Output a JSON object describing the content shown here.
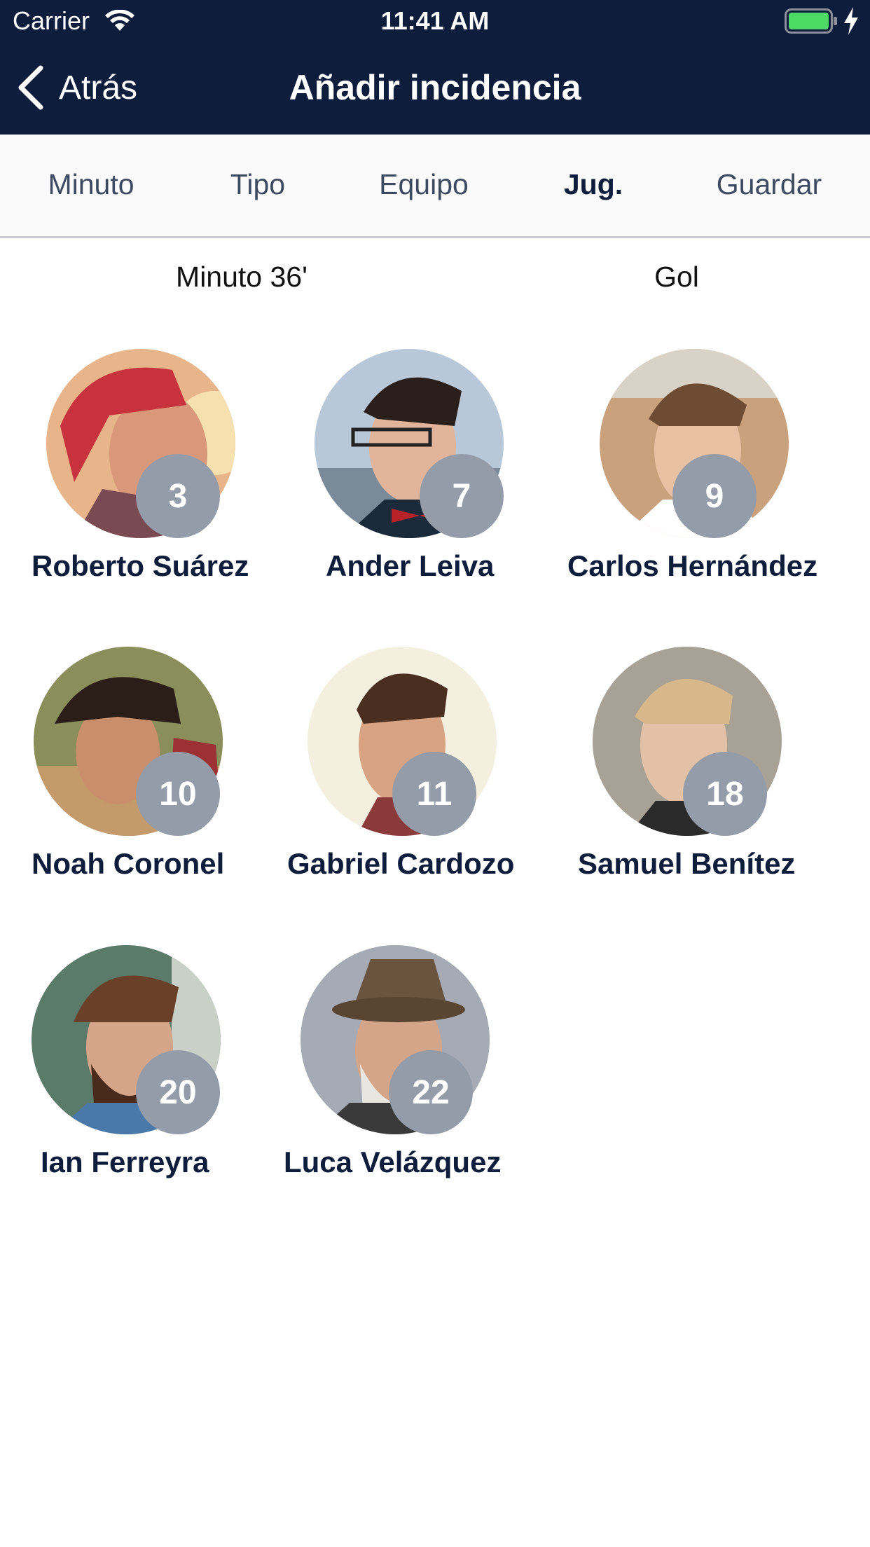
{
  "status_bar": {
    "carrier": "Carrier",
    "time": "11:41 AM"
  },
  "nav": {
    "back_label": "Atrás",
    "title": "Añadir incidencia"
  },
  "steps": [
    {
      "label": "Minuto",
      "active": false
    },
    {
      "label": "Tipo",
      "active": false
    },
    {
      "label": "Equipo",
      "active": false
    },
    {
      "label": "Jug.",
      "active": true
    },
    {
      "label": "Guardar",
      "active": false
    }
  ],
  "summary": {
    "minute": "Minuto 36'",
    "type": "Gol"
  },
  "players": [
    {
      "name": "Roberto Suárez",
      "number": "3"
    },
    {
      "name": "Ander Leiva",
      "number": "7"
    },
    {
      "name": "Carlos Hernández",
      "number": "9"
    },
    {
      "name": "Noah Coronel",
      "number": "10"
    },
    {
      "name": "Gabriel Cardozo",
      "number": "11"
    },
    {
      "name": "Samuel Benítez",
      "number": "18"
    },
    {
      "name": "Ian Ferreyra",
      "number": "20"
    },
    {
      "name": "Luca Velázquez",
      "number": "22"
    }
  ],
  "colors": {
    "header_bg": "#0f1d3d",
    "badge_bg": "#949ca9",
    "battery_fill": "#4cd964"
  }
}
